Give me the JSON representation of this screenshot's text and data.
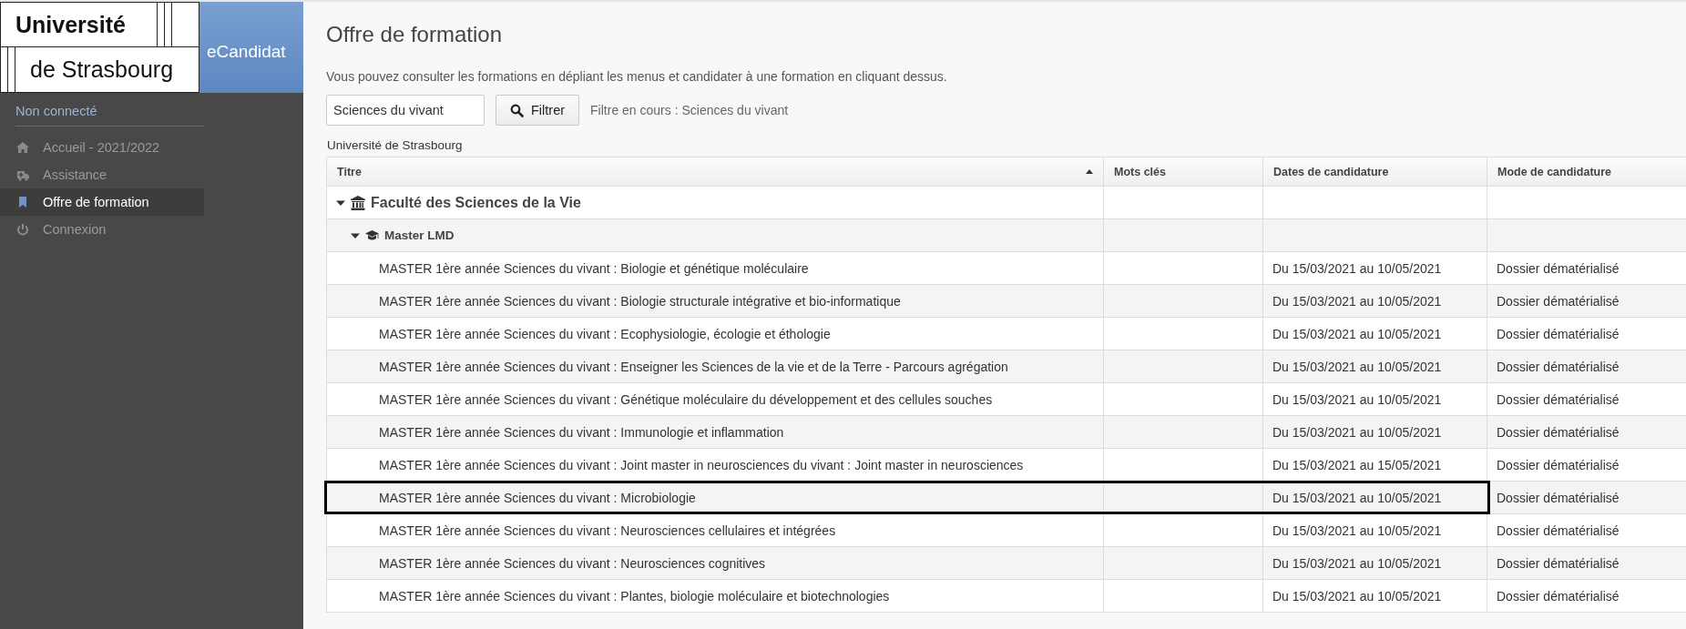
{
  "logo": {
    "line_1": "Université",
    "line_2": "de Strasbourg"
  },
  "app_name": "eCandidat",
  "sidebar": {
    "user_status": "Non connecté",
    "items": [
      {
        "label": "Accueil - 2021/2022",
        "selected": false
      },
      {
        "label": "Assistance",
        "selected": false
      },
      {
        "label": "Offre de formation",
        "selected": true
      },
      {
        "label": "Connexion",
        "selected": false
      }
    ]
  },
  "page": {
    "title": "Offre de formation",
    "intro": "Vous pouvez consulter les formations en dépliant les menus et candidater à une formation en cliquant dessus.",
    "filter": {
      "value": "Sciences du vivant",
      "button": "Filtrer",
      "current": "Filtre en cours : Sciences du vivant"
    },
    "institution": "Université de Strasbourg",
    "table": {
      "columns": [
        {
          "label": "Titre",
          "sorted": true
        },
        {
          "label": "Mots clés",
          "sorted": false
        },
        {
          "label": "Dates de candidature",
          "sorted": false
        },
        {
          "label": "Mode de candidature",
          "sorted": false
        }
      ],
      "rows": [
        {
          "kind": "faculty",
          "title": "Faculté des Sciences de la Vie",
          "expanded": true
        },
        {
          "kind": "degree",
          "title": "Master LMD",
          "expanded": true
        },
        {
          "kind": "course",
          "title": "MASTER 1ère année Sciences du vivant : Biologie et génétique moléculaire",
          "dates": "Du 15/03/2021 au 10/05/2021",
          "mode": "Dossier dématérialisé",
          "highlighted": false
        },
        {
          "kind": "course",
          "title": "MASTER 1ère année Sciences du vivant : Biologie structurale intégrative et bio-informatique",
          "dates": "Du 15/03/2021 au 10/05/2021",
          "mode": "Dossier dématérialisé",
          "highlighted": false
        },
        {
          "kind": "course",
          "title": "MASTER 1ère année Sciences du vivant : Ecophysiologie, écologie et éthologie",
          "dates": "Du 15/03/2021 au 10/05/2021",
          "mode": "Dossier dématérialisé",
          "highlighted": false
        },
        {
          "kind": "course",
          "title": "MASTER 1ère année Sciences du vivant : Enseigner les Sciences de la vie et de la Terre - Parcours agrégation",
          "dates": "Du 15/03/2021 au 10/05/2021",
          "mode": "Dossier dématérialisé",
          "highlighted": false
        },
        {
          "kind": "course",
          "title": "MASTER 1ère année Sciences du vivant : Génétique moléculaire du développement et des cellules souches",
          "dates": "Du 15/03/2021 au 10/05/2021",
          "mode": "Dossier dématérialisé",
          "highlighted": false
        },
        {
          "kind": "course",
          "title": "MASTER 1ère année Sciences du vivant : Immunologie et inflammation",
          "dates": "Du 15/03/2021 au 10/05/2021",
          "mode": "Dossier dématérialisé",
          "highlighted": false
        },
        {
          "kind": "course",
          "title": "MASTER 1ère année Sciences du vivant : Joint master in neurosciences du vivant : Joint master in neurosciences",
          "dates": "Du 15/03/2021 au 15/05/2021",
          "mode": "Dossier dématérialisé",
          "highlighted": false
        },
        {
          "kind": "course",
          "title": "MASTER 1ère année Sciences du vivant : Microbiologie",
          "dates": "Du 15/03/2021 au 10/05/2021",
          "mode": "Dossier dématérialisé",
          "highlighted": true
        },
        {
          "kind": "course",
          "title": "MASTER 1ère année Sciences du vivant : Neurosciences cellulaires et intégrées",
          "dates": "Du 15/03/2021 au 10/05/2021",
          "mode": "Dossier dématérialisé",
          "highlighted": false
        },
        {
          "kind": "course",
          "title": "MASTER 1ère année Sciences du vivant : Neurosciences cognitives",
          "dates": "Du 15/03/2021 au 10/05/2021",
          "mode": "Dossier dématérialisé",
          "highlighted": false
        },
        {
          "kind": "course",
          "title": "MASTER 1ère année Sciences du vivant : Plantes, biologie moléculaire et biotechnologies",
          "dates": "Du 15/03/2021 au 10/05/2021",
          "mode": "Dossier dématérialisé",
          "highlighted": false
        }
      ]
    }
  }
}
